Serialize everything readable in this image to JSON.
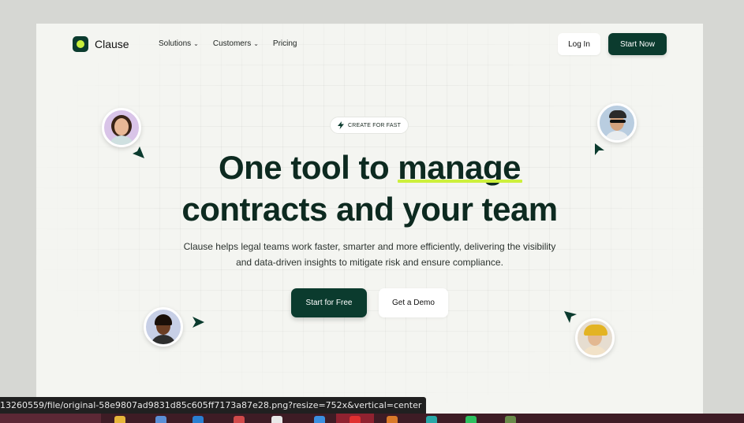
{
  "brand": {
    "name": "Clause",
    "accent": "#0b3b2e",
    "highlight": "#cdf03c"
  },
  "nav": {
    "items": [
      {
        "label": "Solutions",
        "has_dropdown": true
      },
      {
        "label": "Customers",
        "has_dropdown": true
      },
      {
        "label": "Pricing",
        "has_dropdown": false
      }
    ],
    "login_label": "Log In",
    "start_label": "Start Now"
  },
  "hero": {
    "badge": "CREATE FOR FAST",
    "headline_line1_prefix": "One tool to ",
    "headline_line1_highlight": "manage",
    "headline_line2": "contracts and your team",
    "sub_line1": "Clause helps legal teams work faster, smarter and more efficiently, delivering the visibility",
    "sub_line2": "and data-driven insights to mitigate risk and ensure compliance.",
    "cta_primary": "Start for Free",
    "cta_secondary": "Get a Demo"
  },
  "status_url": "13260559/file/original-58e9807ad9831d85c605ff7173a87e28.png?resize=752x&vertical=center",
  "icons": {
    "chevron": "chevron-down-icon",
    "bolt": "bolt-icon",
    "cursor": "cursor-arrow-icon"
  }
}
